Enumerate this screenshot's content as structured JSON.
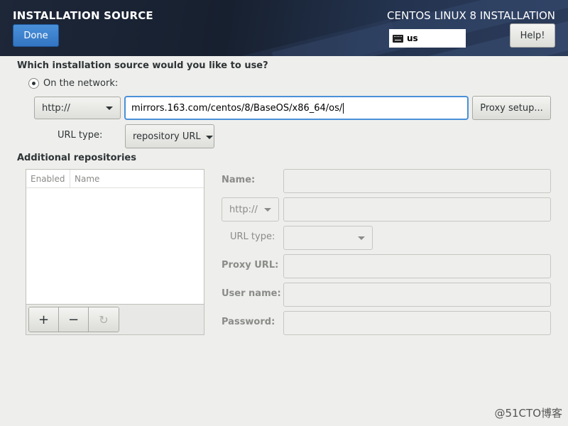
{
  "header": {
    "title": "INSTALLATION SOURCE",
    "product": "CENTOS LINUX 8 INSTALLATION",
    "done_label": "Done",
    "keyboard_layout": "us",
    "help_label": "Help!"
  },
  "source": {
    "question": "Which installation source would you like to use?",
    "network_label": "On the network:",
    "network_selected": true,
    "protocol": "http://",
    "url": "mirrors.163.com/centos/8/BaseOS/x86_64/os/",
    "proxy_button": "Proxy setup...",
    "url_type_label": "URL type:",
    "url_type_value": "repository URL"
  },
  "additional": {
    "title": "Additional repositories",
    "columns": [
      "Enabled",
      "Name"
    ],
    "add": "+",
    "remove": "−",
    "refresh": "↻",
    "form": {
      "name_label": "Name:",
      "protocol": "http://",
      "url_type_label": "URL type:",
      "proxy_url_label": "Proxy URL:",
      "user_name_label": "User name:",
      "password_label": "Password:"
    }
  },
  "watermark": "@51CTO博客",
  "colors": {
    "accent": "#4a90d9",
    "header_bg": "#1d2738",
    "done_button": "#3275c2"
  }
}
